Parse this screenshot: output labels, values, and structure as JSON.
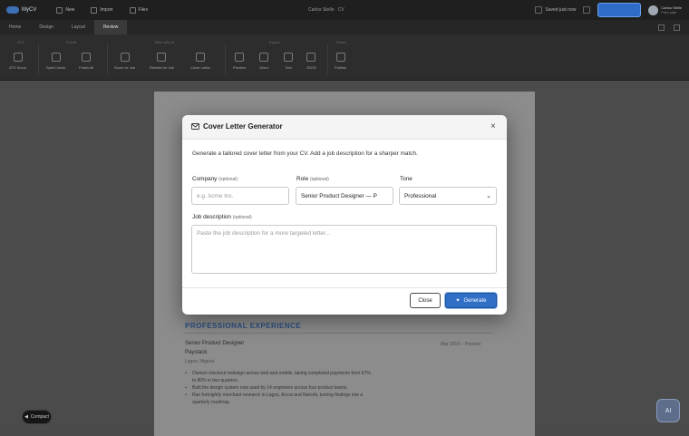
{
  "app": {
    "logo": "MyCV",
    "doc_title": "Carlos Stelle · CV",
    "menu": [
      {
        "label": "New",
        "icon": "new-file-icon"
      },
      {
        "label": "Import",
        "icon": "import-icon"
      },
      {
        "label": "Files",
        "icon": "folder-icon"
      }
    ],
    "save_label": "Saved just now",
    "user_name": "Carlos Stelle",
    "user_plan": "Free plan"
  },
  "tabs": [
    "Home",
    "Design",
    "Layout",
    "Review"
  ],
  "active_tab": "Review",
  "ribbon": {
    "groups": [
      "ATS",
      "Proofs",
      "Tailor with AI",
      "Export",
      "Share"
    ],
    "buttons": [
      {
        "label": "ATS Score",
        "icon": "gauge-icon"
      },
      {
        "label": "Spell Check",
        "icon": "spellcheck-icon"
      },
      {
        "label": "Polish All",
        "icon": "sparkle-icon"
      },
      {
        "label": "Score vs Job",
        "icon": "target-icon"
      },
      {
        "label": "Rewrite for Job",
        "icon": "rewrite-icon"
      },
      {
        "label": "Cover Letter",
        "icon": "letter-icon"
      },
      {
        "label": "Preview",
        "icon": "eye-icon"
      },
      {
        "label": "Word",
        "icon": "word-icon"
      },
      {
        "label": "Text",
        "icon": "text-icon"
      },
      {
        "label": "JSON",
        "icon": "code-icon"
      },
      {
        "label": "Publish",
        "icon": "globe-icon"
      }
    ]
  },
  "resume": {
    "section_title": "PROFESSIONAL EXPERIENCE",
    "job_title": "Senior Product Designer",
    "company": "Paystack",
    "location": "Lagos, Nigeria",
    "dates": "Mar 2019 – Present",
    "bullets": [
      "Owned checkout redesign across web and mobile, taking completed payments from 67%",
      "to 80% in two quarters.",
      "Built the design system now used by 14 engineers across four product teams.",
      "Ran fortnightly merchant research in Lagos, Accra and Nairobi, turning findings into a",
      "quarterly roadmap."
    ]
  },
  "compact_label": "Compact",
  "fab_label": "AI",
  "dialog": {
    "title": "Cover Letter Generator",
    "intro": "Generate a tailored cover letter from your CV. Add a job description for a sharper match.",
    "company_label": "Company",
    "company_optional": "(optional)",
    "company_placeholder": "e.g. Acme Inc.",
    "role_label": "Role",
    "role_optional": "(optional)",
    "role_value": "Senior Product Designer — P",
    "tone_label": "Tone",
    "tone_value": "Professional",
    "job_label": "Job description",
    "job_optional": "(optional)",
    "job_placeholder": "Paste the job description for a more targeted letter...",
    "close_label": "Close",
    "generate_label": "Generate"
  },
  "colors": {
    "accent": "#2f6fc6",
    "resume_heading": "#2c4f84"
  }
}
